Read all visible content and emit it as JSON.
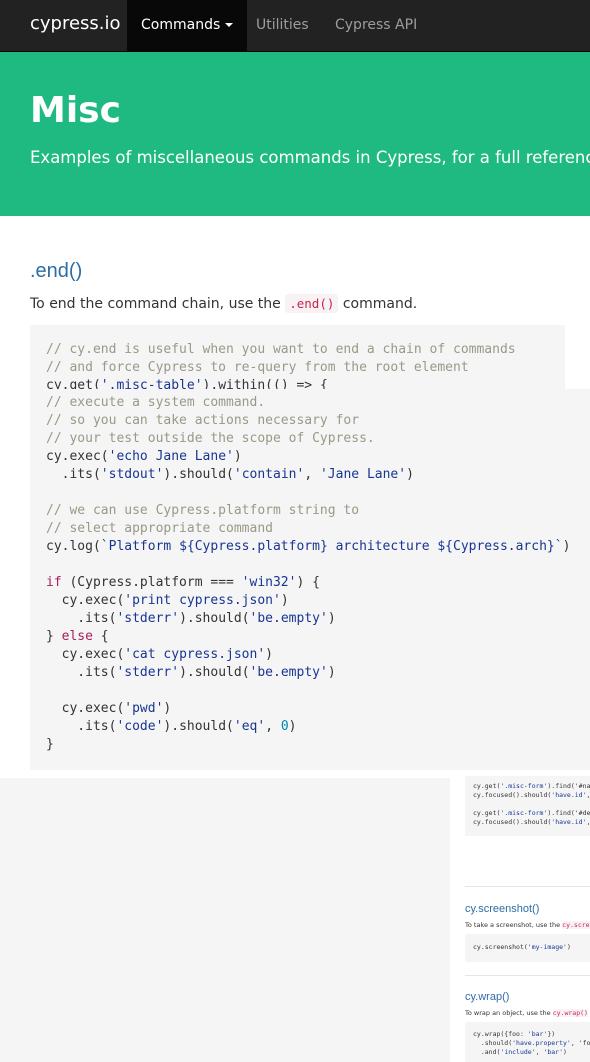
{
  "navbar": {
    "brand": "cypress.io",
    "items": [
      {
        "label": "Commands",
        "active": true,
        "has_caret": true
      },
      {
        "label": "Utilities",
        "active": false
      },
      {
        "label": "Cypress API",
        "active": false
      }
    ]
  },
  "hero": {
    "title": "Misc",
    "subtitle": "Examples of miscellaneous commands in Cypress, for a full reference"
  },
  "section_end": {
    "title": ".end()",
    "desc_before": "To end the command chain, use the ",
    "desc_code": ".end()",
    "desc_after": " command."
  },
  "code_top": [
    "// cy.end is useful when you want to end a chain of commands",
    "// and force Cypress to re-query from the root element",
    "cy.get('.misc-table').within(() => {"
  ],
  "code_main": [
    "// execute a system command.",
    "// so you can take actions necessary for",
    "// your test outside the scope of Cypress.",
    "cy.exec('echo Jane Lane')",
    "  .its('stdout').should('contain', 'Jane Lane')",
    "",
    "// we can use Cypress.platform string to",
    "// select appropriate command",
    "cy.log(`Platform ${Cypress.platform} architecture ${Cypress.arch}`)",
    "",
    "if (Cypress.platform === 'win32') {",
    "  cy.exec('print cypress.json')",
    "    .its('stderr').should('be.empty')",
    "} else {",
    "  cy.exec('cat cypress.json')",
    "    .its('stderr').should('be.empty')",
    "",
    "  cy.exec('pwd')",
    "    .its('code').should('eq', 0)",
    "}"
  ],
  "thumb": {
    "focused_code": [
      "cy.get('.misc-form').find('#na",
      "cy.focused().should('have.id',",
      "",
      "cy.get('.misc-form').find('#de",
      "cy.focused().should('have.id',"
    ],
    "screenshot": {
      "title": "cy.screenshot()",
      "desc_before": "To take a screenshot, use the ",
      "desc_code": "cy.scre",
      "code": [
        "cy.screenshot('my-image')"
      ]
    },
    "wrap": {
      "title": "cy.wrap()",
      "desc_before": "To wrap an object, use the ",
      "desc_code": "cy.wrap()",
      "code": [
        "cy.wrap({foo: 'bar'})",
        "  .should('have.property', 'fo",
        "  .and('include', 'bar')"
      ]
    }
  },
  "colors": {
    "navbar_bg": "#222222",
    "hero_bg": "#1fba82",
    "link": "#2e6da4",
    "code_bg": "#f5f5f5",
    "comment": "#999988",
    "string": "#183691",
    "keyword": "#a71d5d",
    "number": "#0086b3"
  }
}
